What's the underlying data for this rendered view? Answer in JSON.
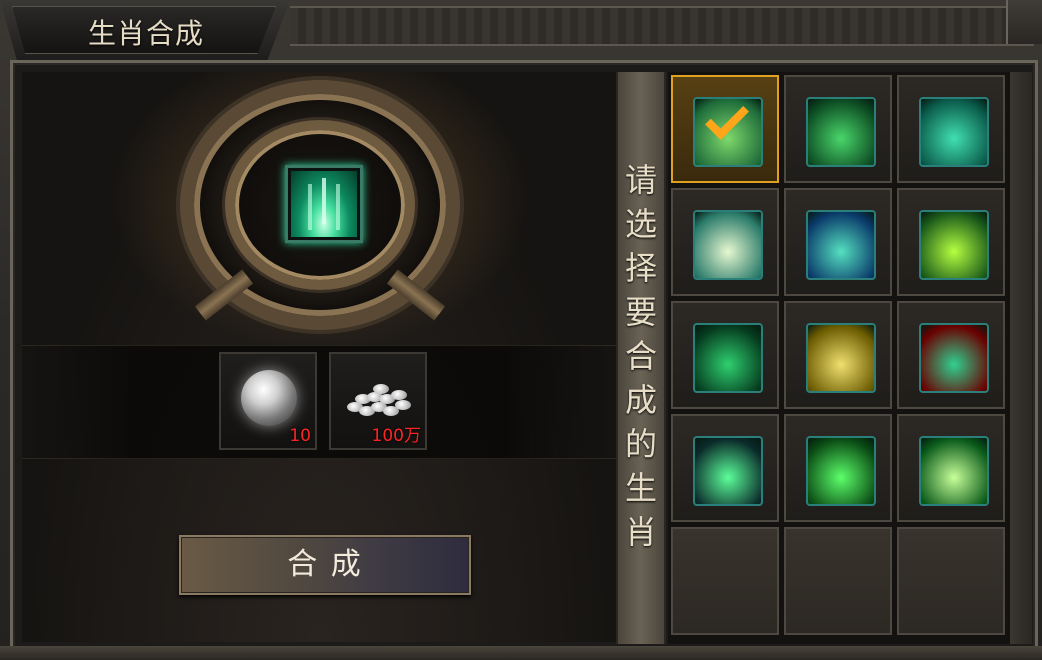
{
  "window": {
    "title": "生肖合成"
  },
  "materials": [
    {
      "name": "moon-orb",
      "count": "10"
    },
    {
      "name": "silver-coins",
      "count": "100万"
    }
  ],
  "merge_button": {
    "label": "合 成"
  },
  "prompt": {
    "text": "请选择要合成的生肖"
  },
  "zodiac_grid": {
    "selected_index": 0,
    "items": [
      {
        "icon": "leaf-sprout-icon",
        "colors": [
          "#1e6b3a",
          "#7ed96b"
        ]
      },
      {
        "icon": "green-spirit-icon",
        "colors": [
          "#0c4a22",
          "#49d66a"
        ]
      },
      {
        "icon": "wind-swirl-icon",
        "colors": [
          "#0a5a4a",
          "#41e0b0"
        ]
      },
      {
        "icon": "vortex-icon",
        "colors": [
          "#2a7a6a",
          "#e6f8d0"
        ]
      },
      {
        "icon": "tree-icon",
        "colors": [
          "#0a3a6a",
          "#55e0c0"
        ]
      },
      {
        "icon": "green-slash-icon",
        "colors": [
          "#1a5a1a",
          "#b6ff40"
        ]
      },
      {
        "icon": "meditation-icon",
        "colors": [
          "#053a1e",
          "#2fd070"
        ]
      },
      {
        "icon": "golden-blade-icon",
        "colors": [
          "#6a5a00",
          "#f0e070"
        ]
      },
      {
        "icon": "red-flower-icon",
        "colors": [
          "#6a0000",
          "#30d090"
        ]
      },
      {
        "icon": "green-ring-icon",
        "colors": [
          "#0a2a2a",
          "#5cff9a"
        ]
      },
      {
        "icon": "green-beast-icon",
        "colors": [
          "#0a4a14",
          "#5cff6a"
        ]
      },
      {
        "icon": "green-flame-icon",
        "colors": [
          "#0a5a1a",
          "#c8ff9a"
        ]
      }
    ],
    "empty_slots": 3
  }
}
